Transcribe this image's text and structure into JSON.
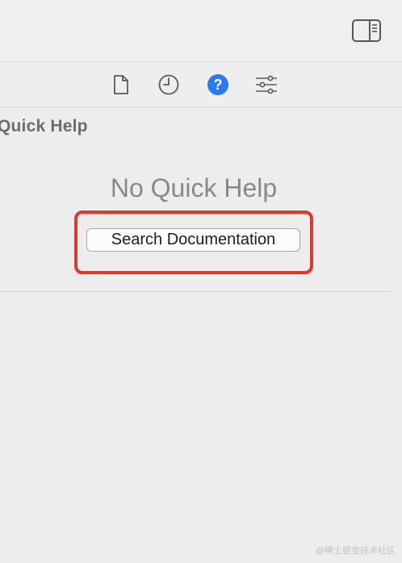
{
  "toolbar": {
    "inspector_toggle_icon": "sidebar-right-icon"
  },
  "inspector_tabs": [
    {
      "icon": "file-icon",
      "selected": false
    },
    {
      "icon": "history-clock-icon",
      "selected": false
    },
    {
      "icon": "quick-help-icon",
      "selected": true
    },
    {
      "icon": "attributes-sliders-icon",
      "selected": false
    }
  ],
  "quick_help": {
    "section_title": "Quick Help",
    "empty_message": "No Quick Help",
    "search_button_label": "Search Documentation"
  },
  "watermark": "@稀土掘金技术社区",
  "colors": {
    "accent": "#2a7af5",
    "highlight": "#e2352c"
  }
}
